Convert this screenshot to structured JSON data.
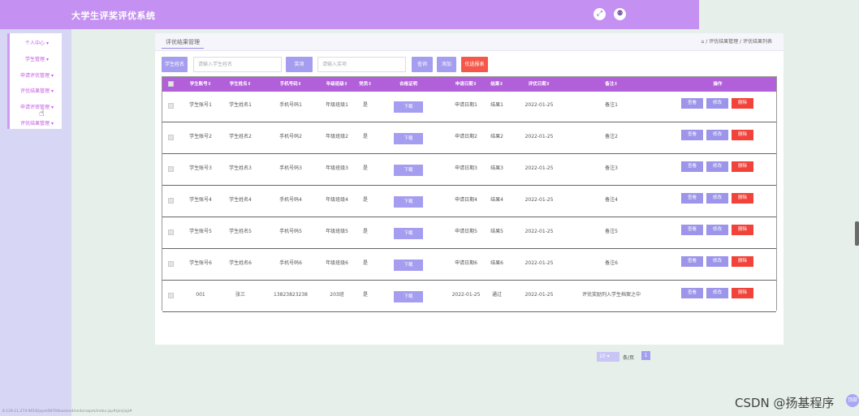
{
  "app": {
    "title": "大学生评奖评优系统",
    "icons": [
      "fullscreen-icon",
      "user-icon"
    ],
    "icon_glyphs": {
      "fullscreen": "⤢",
      "user": "⚉"
    }
  },
  "sidebar": {
    "items": [
      {
        "label": "个人中心 ▾"
      },
      {
        "label": "学生管理 ▾"
      },
      {
        "label": "申请评优管理 ▾"
      },
      {
        "label": "评优结果管理 ▾"
      },
      {
        "label": "申请评审管理 ▾"
      },
      {
        "label": "评优结果管理 ▾"
      }
    ],
    "cursor_glyph": "☝"
  },
  "header": {
    "tab": "评优结果管理",
    "breadcrumb": "⌂ / 评优结果管理 / 评优结果列表"
  },
  "search": {
    "btn_student_name": "学生姓名",
    "name_placeholder": "请输入学生姓名",
    "btn_prize": "奖项",
    "prize_placeholder": "请输入奖项",
    "btn_query": "查询",
    "btn_add": "添加",
    "btn_report": "优选报表"
  },
  "table": {
    "headers": [
      "学生账号⇕",
      "学生姓名⇕",
      "手机号码⇕",
      "年级班级⇕",
      "党员⇕",
      "合格证明",
      "申请日期⇕",
      "结果⇕",
      "评优日期⇕",
      "备注⇕",
      "操作"
    ],
    "download_label": "下载",
    "action_view": "查看",
    "action_edit": "修改",
    "action_delete": "删除",
    "rows": [
      [
        "学生账号1",
        "学生姓名1",
        "手机号码1",
        "年级班级1",
        "是",
        "申请日期1",
        "结果1",
        "2022-01-25",
        "备注1"
      ],
      [
        "学生账号2",
        "学生姓名2",
        "手机号码2",
        "年级班级2",
        "是",
        "申请日期2",
        "结果2",
        "2022-01-25",
        "备注2"
      ],
      [
        "学生账号3",
        "学生姓名3",
        "手机号码3",
        "年级班级3",
        "是",
        "申请日期3",
        "结果3",
        "2022-01-25",
        "备注3"
      ],
      [
        "学生账号4",
        "学生姓名4",
        "手机号码4",
        "年级班级4",
        "是",
        "申请日期4",
        "结果4",
        "2022-01-25",
        "备注4"
      ],
      [
        "学生账号5",
        "学生姓名5",
        "手机号码5",
        "年级班级5",
        "是",
        "申请日期5",
        "结果5",
        "2022-01-25",
        "备注5"
      ],
      [
        "学生账号6",
        "学生姓名6",
        "手机号码6",
        "年级班级6",
        "是",
        "申请日期6",
        "结果6",
        "2022-01-25",
        "备注6"
      ],
      [
        "001",
        "张三",
        "13823823238",
        "203班",
        "是",
        "2022-01-25",
        "通过",
        "2022-01-25",
        "评优奖励列入学生档案之中"
      ]
    ]
  },
  "pager": {
    "page_size": "10",
    "page_size_suffix": "条/页",
    "current_page": "1"
  },
  "footer": {
    "url": "8.129.11.274:9018/jspm0879/backend/endoraspm/index.jsp#/pinjiaji#",
    "watermark": "CSDN @扬基程序",
    "corner_btn": "顶部"
  }
}
